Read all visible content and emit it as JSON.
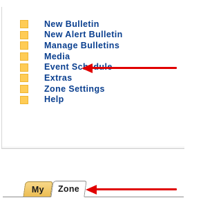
{
  "menu": {
    "items": [
      {
        "label": "New Bulletin"
      },
      {
        "label": "New Alert Bulletin"
      },
      {
        "label": "Manage Bulletins"
      },
      {
        "label": "Media"
      },
      {
        "label": "Event Schedule"
      },
      {
        "label": "Extras"
      },
      {
        "label": "Zone Settings"
      },
      {
        "label": "Help"
      }
    ]
  },
  "tabs": [
    {
      "label": "My",
      "active": false
    },
    {
      "label": "Zone",
      "active": true
    }
  ],
  "colors": {
    "link": "#0a3f8f",
    "bullet": "#ffcc55",
    "arrow": "#e00000",
    "inactive_tab": "#ecbd52"
  }
}
